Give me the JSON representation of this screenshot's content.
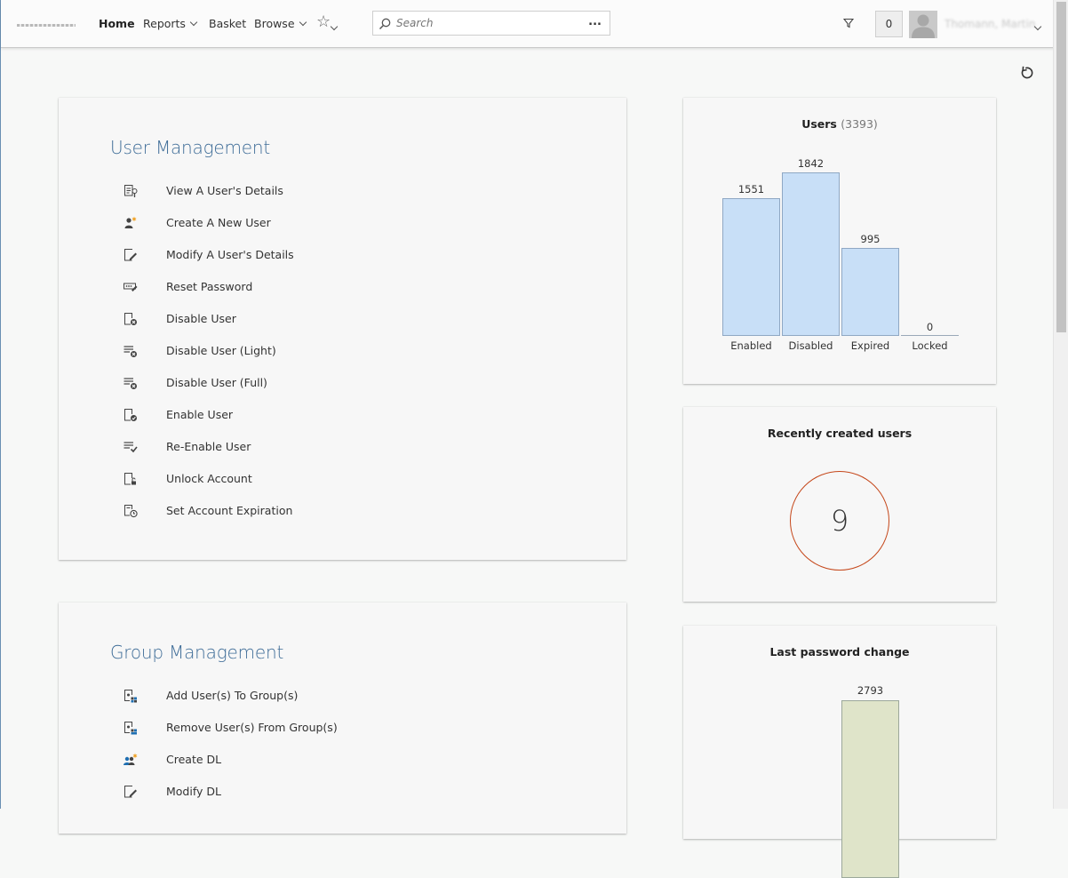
{
  "nav": {
    "items": [
      {
        "label": "Home",
        "active": true,
        "dropdown": false
      },
      {
        "label": "Reports",
        "active": false,
        "dropdown": true
      },
      {
        "label": "Basket",
        "active": false,
        "dropdown": false
      },
      {
        "label": "Browse",
        "active": false,
        "dropdown": true
      }
    ],
    "favorites_icon": "star-icon",
    "search": {
      "placeholder": "Search",
      "more_label": "..."
    },
    "filter_icon": "filter-icon",
    "counter": "0",
    "user_name": "Thomann, Martin"
  },
  "refresh_icon": "refresh-icon",
  "user_management": {
    "title": "User Management",
    "actions": [
      {
        "label": "View A User's Details",
        "icon": "view-user-details-icon"
      },
      {
        "label": "Create A New User",
        "icon": "create-user-icon"
      },
      {
        "label": "Modify A User's Details",
        "icon": "modify-user-icon"
      },
      {
        "label": "Reset Password",
        "icon": "reset-password-icon"
      },
      {
        "label": "Disable User",
        "icon": "disable-user-icon"
      },
      {
        "label": "Disable User (Light)",
        "icon": "disable-user-light-icon"
      },
      {
        "label": "Disable User (Full)",
        "icon": "disable-user-full-icon"
      },
      {
        "label": "Enable User",
        "icon": "enable-user-icon"
      },
      {
        "label": "Re-Enable User",
        "icon": "re-enable-user-icon"
      },
      {
        "label": "Unlock Account",
        "icon": "unlock-account-icon"
      },
      {
        "label": "Set Account Expiration",
        "icon": "set-expiration-icon"
      }
    ]
  },
  "group_management": {
    "title": "Group Management",
    "actions": [
      {
        "label": "Add User(s) To Group(s)",
        "icon": "add-to-group-icon"
      },
      {
        "label": "Remove User(s) From Group(s)",
        "icon": "remove-from-group-icon"
      },
      {
        "label": "Create DL",
        "icon": "create-dl-icon"
      },
      {
        "label": "Modify DL",
        "icon": "modify-dl-icon"
      }
    ]
  },
  "users_widget": {
    "title": "Users",
    "total": "(3393)"
  },
  "recent_widget": {
    "title": "Recently created users",
    "value": "9"
  },
  "password_widget": {
    "title": "Last password change"
  },
  "colors": {
    "title_blue": "#3f6d98",
    "bar_fill": "#c8dff7",
    "circle_stroke": "#c5471a",
    "pw_bar_fill": "#dfe4c9"
  },
  "chart_data": [
    {
      "type": "bar",
      "title": "Users",
      "categories": [
        "Enabled",
        "Disabled",
        "Expired",
        "Locked"
      ],
      "values": [
        1551,
        1842,
        995,
        0
      ],
      "ylim": [
        0,
        1842
      ],
      "grid": false
    },
    {
      "type": "bar",
      "title": "Last password change",
      "categories": [
        ""
      ],
      "values": [
        2793
      ],
      "grid": false
    }
  ]
}
